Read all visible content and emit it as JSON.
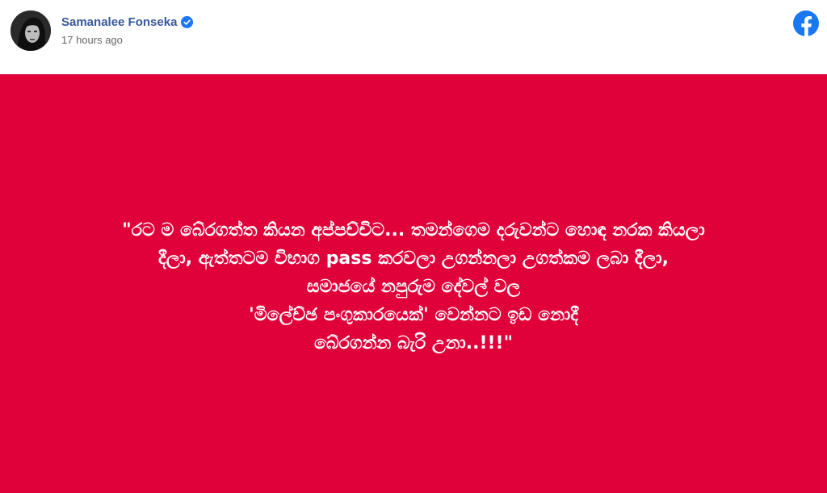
{
  "post": {
    "author": "Samanalee Fonseka",
    "timestamp": "17 hours ago",
    "verified": true,
    "platform_icon": "facebook-icon",
    "banner_color": "#e0003a",
    "accent_color": "#385898",
    "quote_lines": [
      "\"රට ම බේරගත්ත කියන අප්පච්චිට... තමන්ගෙම දරුවන්ට හොඳ නරක කියලා",
      "දීලා, ඇත්තටම විභාග pass කරවලා උගන්නලා උගත්කම ලබා දීලා,",
      "සමාජයේ නපුරුම දේවල් වල",
      "'මිලේච්ඡ පංගුකාරයෙක්' වෙන්නට ඉඩ නොදී",
      "බේරගන්න බැරි උනා..!!!\""
    ]
  }
}
